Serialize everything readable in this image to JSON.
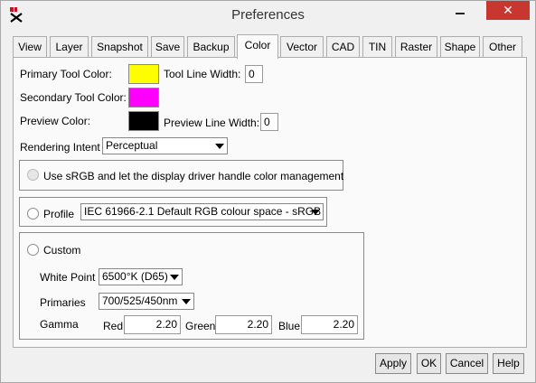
{
  "window": {
    "title": "Preferences"
  },
  "tabs": [
    {
      "label": "View"
    },
    {
      "label": "Layer"
    },
    {
      "label": "Snapshot"
    },
    {
      "label": "Save"
    },
    {
      "label": "Backup"
    },
    {
      "label": "Color"
    },
    {
      "label": "Vector"
    },
    {
      "label": "CAD"
    },
    {
      "label": "TIN"
    },
    {
      "label": "Raster"
    },
    {
      "label": "Shape"
    },
    {
      "label": "Other"
    }
  ],
  "active_tab": "Color",
  "color": {
    "primary_label": "Primary Tool Color:",
    "primary_color": "#ffff00",
    "tool_line_width_label": "Tool Line Width:",
    "tool_line_width": "0",
    "secondary_label": "Secondary Tool Color:",
    "secondary_color": "#ff00ff",
    "preview_label": "Preview Color:",
    "preview_color": "#000000",
    "preview_line_width_label": "Preview Line Width:",
    "preview_line_width": "0",
    "rendering_intent_label": "Rendering Intent",
    "rendering_intent": "Perceptual"
  },
  "management": {
    "srgb_option": "Use sRGB and let the display driver handle color management",
    "profile_label": "Profile",
    "profile_value": "IEC 61966-2.1 Default RGB colour space - sRGB",
    "custom_label": "Custom",
    "white_point_label": "White Point",
    "white_point": "6500°K (D65)",
    "primaries_label": "Primaries",
    "primaries": "700/525/450nm",
    "gamma_label": "Gamma",
    "red_label": "Red",
    "red": "2.20",
    "green_label": "Green",
    "green": "2.20",
    "blue_label": "Blue",
    "blue": "2.20"
  },
  "buttons": {
    "apply": "Apply",
    "ok": "OK",
    "cancel": "Cancel",
    "help": "Help"
  }
}
